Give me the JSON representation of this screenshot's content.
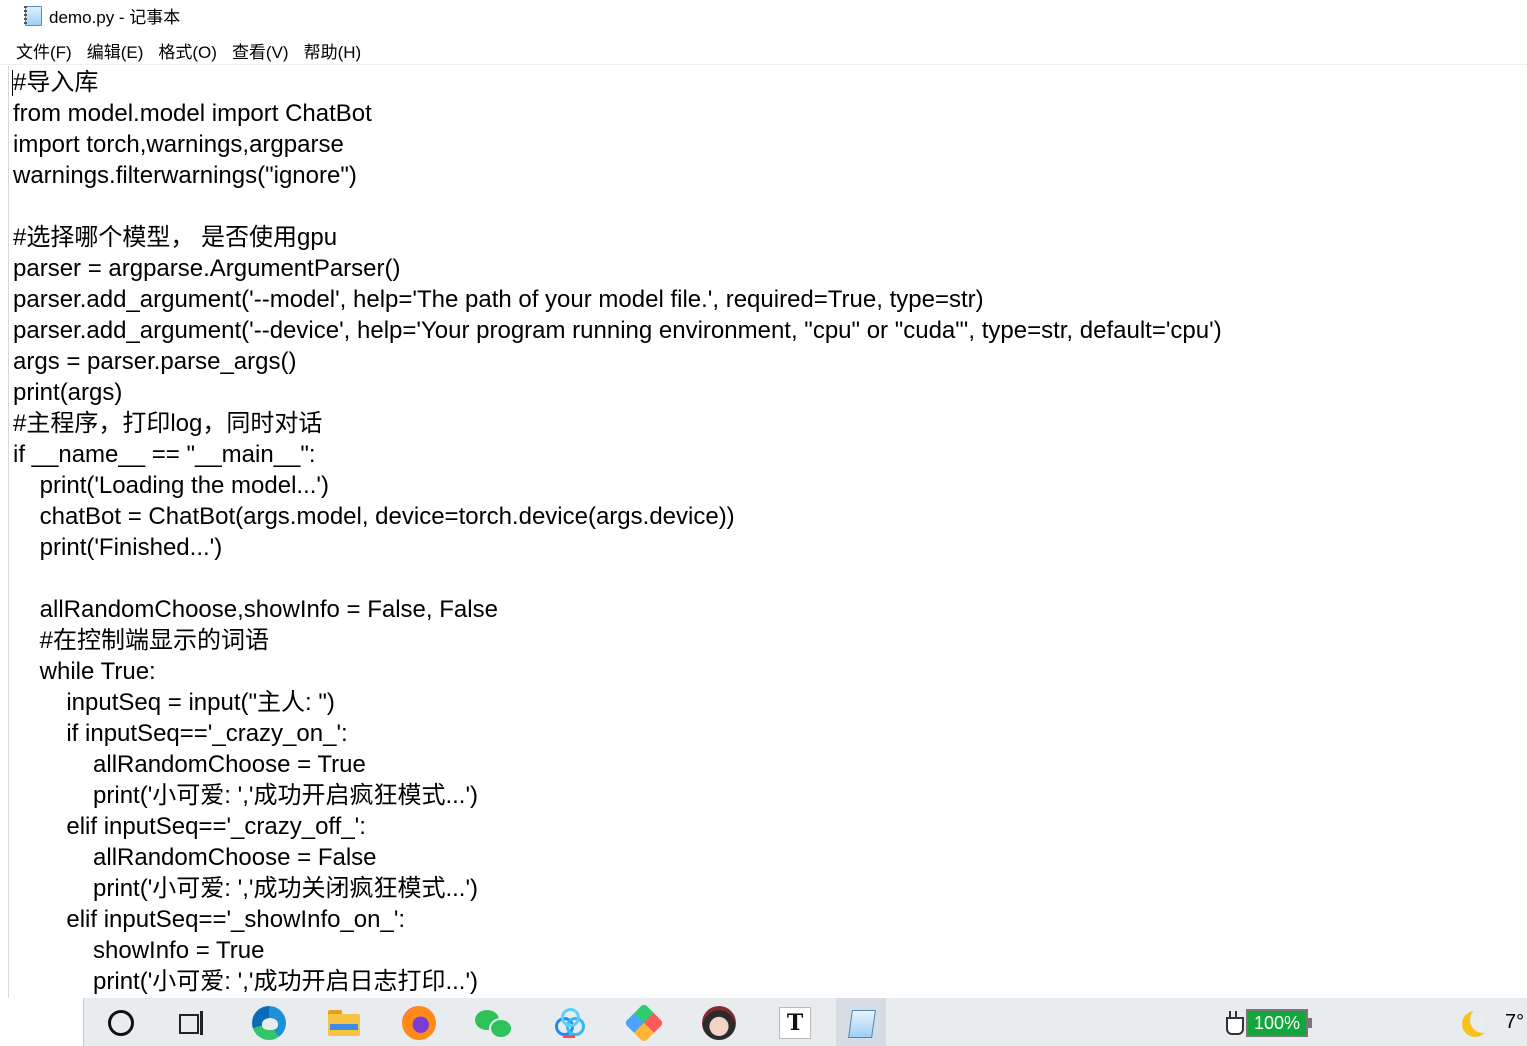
{
  "window": {
    "title": "demo.py - 记事本"
  },
  "menu": [
    {
      "label": "文件(F)"
    },
    {
      "label": "编辑(E)"
    },
    {
      "label": "格式(O)"
    },
    {
      "label": "查看(V)"
    },
    {
      "label": "帮助(H)"
    }
  ],
  "code_lines": [
    "#导入库",
    "from model.model import ChatBot",
    "import torch,warnings,argparse",
    "warnings.filterwarnings(\"ignore\")",
    "",
    "#选择哪个模型， 是否使用gpu",
    "parser = argparse.ArgumentParser()",
    "parser.add_argument('--model', help='The path of your model file.', required=True, type=str)",
    "parser.add_argument('--device', help='Your program running environment, \"cpu\" or \"cuda\"', type=str, default='cpu')",
    "args = parser.parse_args()",
    "print(args)",
    "#主程序，打印log，同时对话",
    "if __name__ == \"__main__\":",
    "    print('Loading the model...')",
    "    chatBot = ChatBot(args.model, device=torch.device(args.device))",
    "    print('Finished...')",
    "",
    "    allRandomChoose,showInfo = False, False",
    "    #在控制端显示的词语",
    "    while True:",
    "        inputSeq = input(\"主人: \")",
    "        if inputSeq=='_crazy_on_':",
    "            allRandomChoose = True",
    "            print('小可爱: ','成功开启疯狂模式...')",
    "        elif inputSeq=='_crazy_off_':",
    "            allRandomChoose = False",
    "            print('小可爱: ','成功关闭疯狂模式...')",
    "        elif inputSeq=='_showInfo_on_':",
    "            showInfo = True",
    "            print('小可爱: ','成功开启日志打印...')"
  ],
  "taskbar": {
    "apps": [
      {
        "icon": "cortana-search-icon"
      },
      {
        "icon": "task-view-icon"
      },
      {
        "icon": "edge-browser-icon"
      },
      {
        "icon": "file-explorer-icon"
      },
      {
        "icon": "firefox-icon"
      },
      {
        "icon": "wechat-icon"
      },
      {
        "icon": "baidu-netdisk-icon"
      },
      {
        "icon": "git-diamond-icon"
      },
      {
        "icon": "user-avatar-app-icon"
      },
      {
        "icon": "typora-icon"
      },
      {
        "icon": "notepad-icon"
      }
    ],
    "battery_percent": "100%",
    "temperature": "7°"
  }
}
